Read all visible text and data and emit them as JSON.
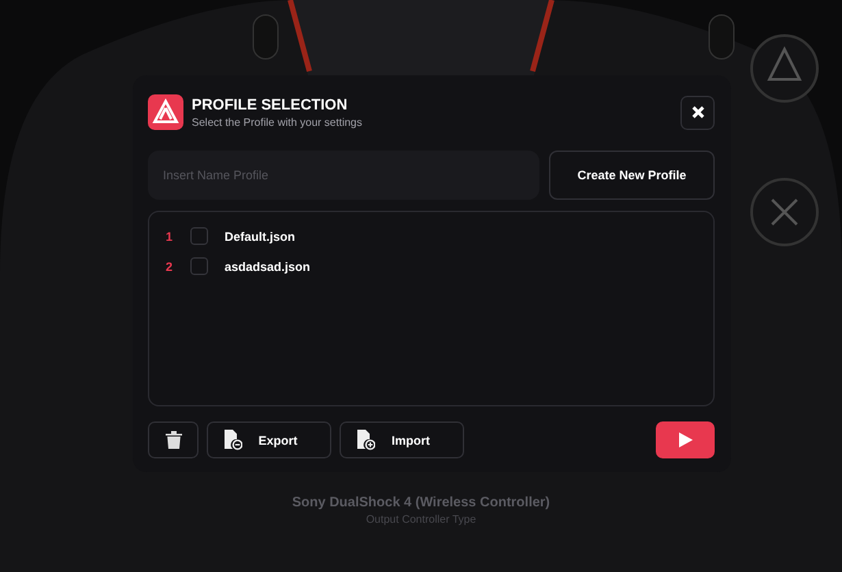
{
  "dialog": {
    "title": "PROFILE SELECTION",
    "subtitle": "Select the Profile with your settings"
  },
  "name_field": {
    "placeholder": "Insert Name Profile"
  },
  "create_button": "Create New Profile",
  "profiles": [
    {
      "number": "1",
      "name": "Default.json",
      "checked": false
    },
    {
      "number": "2",
      "name": "asdadsad.json",
      "checked": false
    }
  ],
  "footer_buttons": [
    {
      "kind": "delete"
    },
    {
      "kind": "export",
      "label": "Export"
    },
    {
      "kind": "import",
      "label": "Import"
    },
    {
      "kind": "play"
    }
  ],
  "controller": {
    "name": "Sony DualShock 4 (Wireless Controller)",
    "caption": "Output Controller Type"
  }
}
